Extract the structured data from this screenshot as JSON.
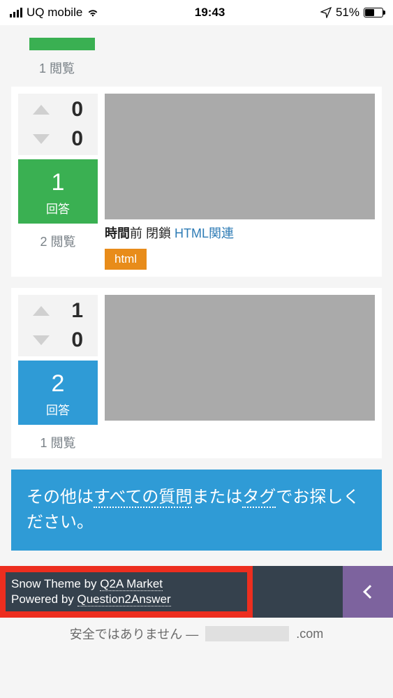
{
  "status": {
    "carrier": "UQ mobile",
    "time": "19:43",
    "battery": "51%"
  },
  "card0": {
    "views_label": "1 閲覧"
  },
  "card1": {
    "upvotes": "0",
    "downvotes": "0",
    "answers": "1",
    "answer_label": "回答",
    "views_label": "2 閲覧",
    "meta_bold": "時間",
    "meta_ago": "前",
    "meta_closed": "閉鎖",
    "meta_link": "HTML関連",
    "tag": "html"
  },
  "card2": {
    "upvotes": "1",
    "downvotes": "0",
    "answers": "2",
    "answer_label": "回答",
    "views_label": "1 閲覧"
  },
  "banner": {
    "pre": "その他は",
    "all_q": "すべての質問",
    "mid": "または",
    "tag": "タグ",
    "post": "でお探しください。"
  },
  "footer": {
    "theme": "Snow Theme by ",
    "theme_link": "Q2A Market",
    "powered": "Powered by ",
    "powered_link": "Question2Answer"
  },
  "browser": {
    "insecure": "安全ではありません —",
    "domain_suffix": ".com"
  }
}
